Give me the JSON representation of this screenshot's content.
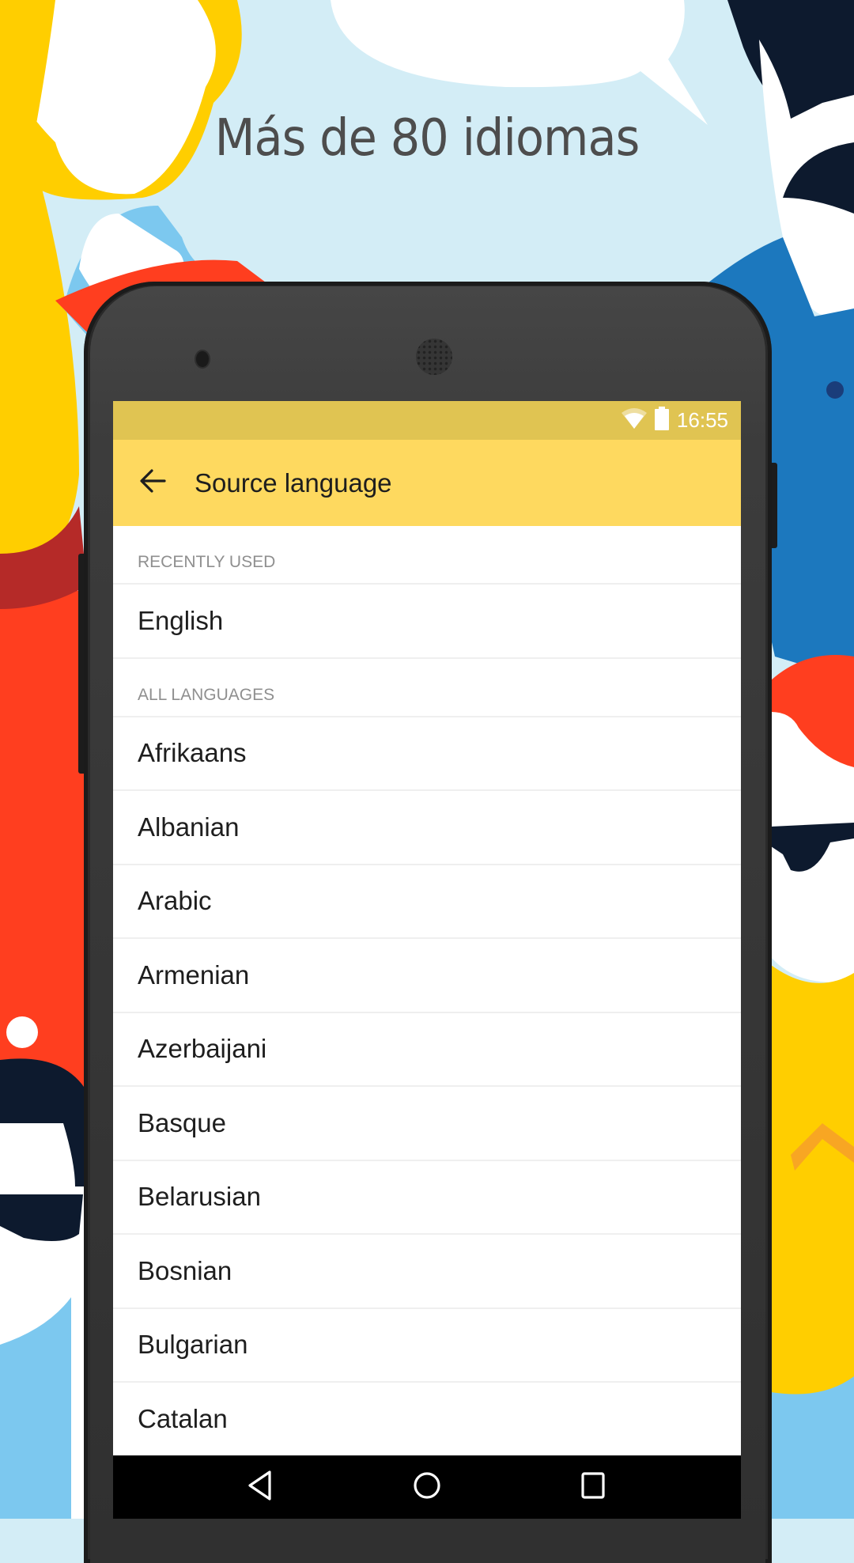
{
  "promo": {
    "headline": "Más de 80 idiomas"
  },
  "status_bar": {
    "time": "16:55",
    "icons": [
      "wifi-icon",
      "battery-icon"
    ]
  },
  "toolbar": {
    "back_icon": "arrow-left-icon",
    "title": "Source language"
  },
  "sections": {
    "recent": {
      "header": "RECENTLY USED",
      "items": [
        "English"
      ]
    },
    "all": {
      "header": "ALL LANGUAGES",
      "items": [
        "Afrikaans",
        "Albanian",
        "Arabic",
        "Armenian",
        "Azerbaijani",
        "Basque",
        "Belarusian",
        "Bosnian",
        "Bulgarian",
        "Catalan"
      ]
    }
  },
  "nav_bar": {
    "buttons": [
      "back-triangle-icon",
      "home-circle-icon",
      "recents-square-icon"
    ]
  },
  "colors": {
    "toolbar": "#fed95f",
    "status_bar": "#e0c452",
    "background": "#d3edf6"
  }
}
